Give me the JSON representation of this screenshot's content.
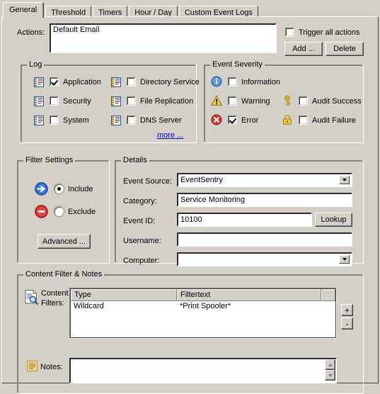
{
  "colors": {
    "dialog_bg": "#d4d0c8",
    "field_bg": "#ffffff",
    "link": "#0000c8",
    "info_icon": "#3a6fc4",
    "warning_icon": "#f5c518",
    "error_icon": "#d82020",
    "key_icon": "#e8b820",
    "lock_icon": "#e8b820",
    "include_icon": "#1a5fd0",
    "exclude_icon": "#d82020"
  },
  "tabs": [
    {
      "label": "General",
      "active": true
    },
    {
      "label": "Threshold",
      "active": false
    },
    {
      "label": "Timers",
      "active": false
    },
    {
      "label": "Hour / Day",
      "active": false
    },
    {
      "label": "Custom Event Logs",
      "active": false
    }
  ],
  "actions": {
    "label": "Actions:",
    "value": "Default Email",
    "trigger_all": {
      "label": "Trigger all actions",
      "checked": false
    },
    "add_button": "Add ...",
    "delete_button": "Delete"
  },
  "log": {
    "title": "Log",
    "items": [
      {
        "label": "Application",
        "checked": true,
        "icon": "event-log-icon"
      },
      {
        "label": "Directory Service",
        "checked": false,
        "icon": "event-log-icon"
      },
      {
        "label": "Security",
        "checked": false,
        "icon": "event-log-icon"
      },
      {
        "label": "File Replication",
        "checked": false,
        "icon": "event-log-icon"
      },
      {
        "label": "System",
        "checked": false,
        "icon": "event-log-icon"
      },
      {
        "label": "DNS Server",
        "checked": false,
        "icon": "event-log-icon"
      }
    ],
    "more_link": "more ..."
  },
  "severity": {
    "title": "Event Severity",
    "items": [
      {
        "label": "Information",
        "checked": false,
        "icon": "information-icon"
      },
      {
        "label": "Warning",
        "checked": false,
        "icon": "warning-icon"
      },
      {
        "label": "Audit Success",
        "checked": false,
        "icon": "key-icon"
      },
      {
        "label": "Error",
        "checked": true,
        "icon": "error-icon"
      },
      {
        "label": "Audit Failure",
        "checked": false,
        "icon": "lock-icon"
      }
    ]
  },
  "filter_settings": {
    "title": "Filter Settings",
    "include": {
      "label": "Include",
      "selected": true,
      "icon": "blue-arrow-icon"
    },
    "exclude": {
      "label": "Exclude",
      "selected": false,
      "icon": "red-minus-icon"
    },
    "advanced_button": "Advanced ..."
  },
  "details": {
    "title": "Details",
    "fields": [
      {
        "label": "Event Source:",
        "value": "EventSentry",
        "type": "combobox"
      },
      {
        "label": "Category:",
        "value": "Service Monitoring",
        "type": "textbox"
      },
      {
        "label": "Event ID:",
        "value": "10100",
        "type": "textbox"
      },
      {
        "label": "Username:",
        "value": "",
        "type": "textbox"
      },
      {
        "label": "Computer:",
        "value": "",
        "type": "combobox"
      }
    ],
    "lookup_button": "Lookup"
  },
  "content_filter": {
    "title": "Content Filter & Notes",
    "content_filters_label_line1": "Content",
    "content_filters_label_line2": "Filters:",
    "content_filters_icon": "document-search-icon",
    "columns": [
      "Type",
      "Filtertext",
      ""
    ],
    "rows": [
      {
        "type": "Wildcard",
        "filtertext": "*Print Spooler*"
      }
    ],
    "add_button": "+",
    "remove_button": "-",
    "notes_label": "Notes:",
    "notes_value": "",
    "notes_icon": "notes-icon"
  }
}
